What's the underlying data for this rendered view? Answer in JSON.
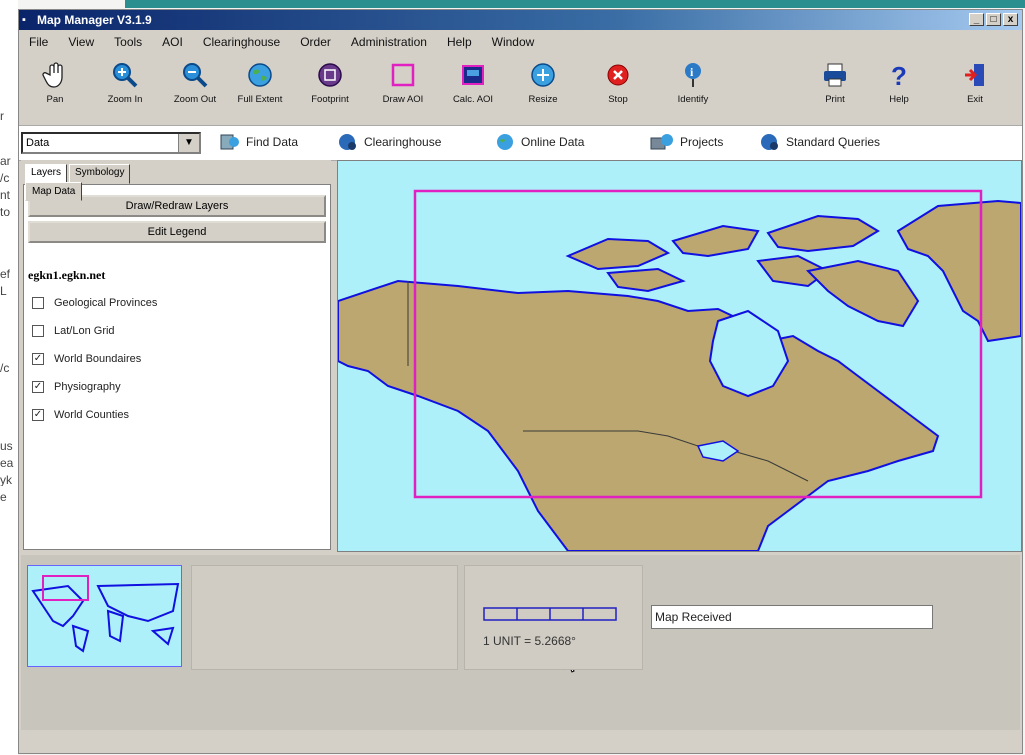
{
  "background_doc": {
    "fragments": [
      "r",
      "ar",
      "/c",
      "nt",
      "to",
      "ef",
      "L",
      "/c",
      "us",
      "ea",
      "yk",
      "e"
    ]
  },
  "window": {
    "title": "Map Manager V3.1.9",
    "controls": [
      "_",
      "□",
      "x"
    ]
  },
  "menu": [
    "File",
    "View",
    "Tools",
    "AOI",
    "Clearinghouse",
    "Order",
    "Administration",
    "Help",
    "Window"
  ],
  "toolbar": {
    "pan": "Pan",
    "zoom_in": "Zoom In",
    "zoom_out": "Zoom Out",
    "full_extent": "Full Extent",
    "footprint": "Footprint",
    "draw_aoi": "Draw AOI",
    "calc_aoi": "Calc. AOI",
    "resize": "Resize",
    "stop": "Stop",
    "identify": "Identify",
    "print": "Print",
    "help": "Help",
    "exit": "Exit"
  },
  "query_bar": {
    "selected": "Data",
    "find_data": "Find Data",
    "clearinghouse": "Clearinghouse",
    "online_data": "Online Data",
    "projects": "Projects",
    "standard_queries": "Standard Queries"
  },
  "left_panel": {
    "tabs": [
      "Layers",
      "Symbology"
    ],
    "draw_button": "Draw/Redraw Layers",
    "legend_button": "Edit Legend",
    "server": "egkn1.egkn.net",
    "layers": [
      {
        "name": "Geological Provinces",
        "checked": false
      },
      {
        "name": "Lat/Lon Grid",
        "checked": false
      },
      {
        "name": "World Boundaires",
        "checked": true
      },
      {
        "name": "Physiography",
        "checked": true
      },
      {
        "name": "World Counties",
        "checked": true
      }
    ]
  },
  "bottom": {
    "scale_text": "1 UNIT = 5.2668°",
    "status": "Map Received",
    "tab": "Map Data"
  },
  "colors": {
    "water": "#aef0fa",
    "land": "#bba76f",
    "coast": "#1010e0",
    "aoi": "#e020c0"
  }
}
